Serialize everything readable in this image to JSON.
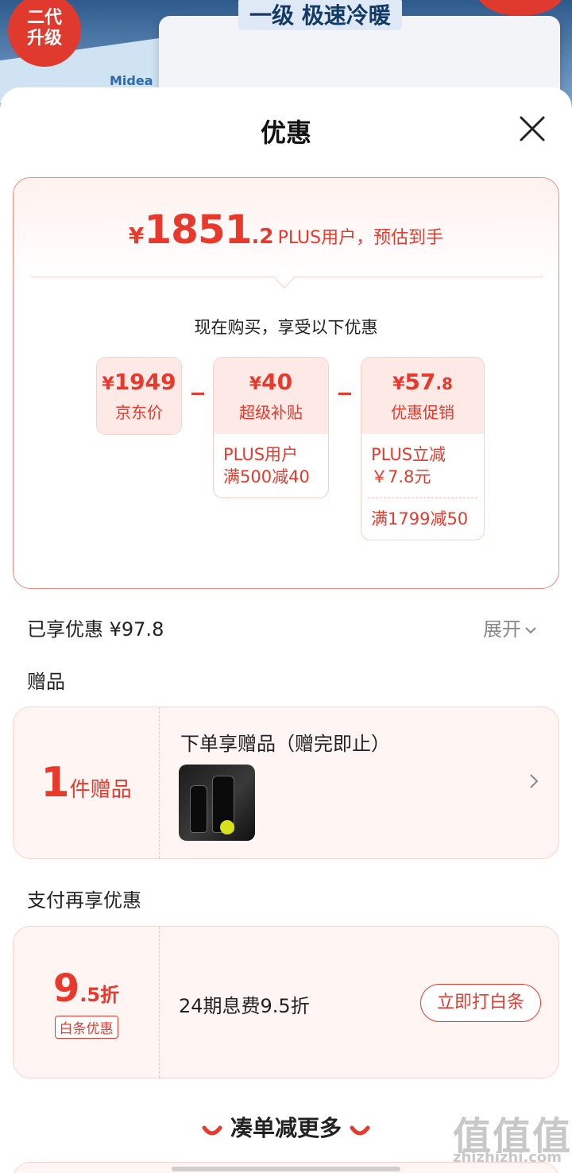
{
  "background": {
    "badge_text": "二代\n升级",
    "slogan": "一级 极速冷暖",
    "brand": "Midea"
  },
  "sheet": {
    "title": "优惠",
    "final_price": {
      "currency": "¥",
      "integer": "1851",
      "decimal": ".2",
      "suffix": "PLUS用户，预估到手"
    },
    "now_buy_text": "现在购买，享受以下优惠",
    "chips": [
      {
        "currency": "¥",
        "amount": "1949",
        "decimal": "",
        "name": "京东价",
        "details": []
      },
      {
        "currency": "¥",
        "amount": "40",
        "decimal": "",
        "name": "超级补贴",
        "details": [
          "PLUS用户\n满500减40"
        ]
      },
      {
        "currency": "¥",
        "amount": "57",
        "decimal": ".8",
        "name": "优惠促销",
        "details": [
          "PLUS立减\n￥7.8元",
          "满1799减50"
        ]
      }
    ],
    "enjoyed_label": "已享优惠 ¥97.8",
    "expand_label": "展开",
    "gift_section_title": "赠品",
    "gift": {
      "count": "1",
      "unit": "件赠品",
      "description": "下单享赠品（赠完即止）",
      "thumb_text": ""
    },
    "pay_section_title": "支付再享优惠",
    "pay": {
      "discount_big": "9",
      "discount_small": ".5折",
      "tag": "白条优惠",
      "description": "24期息费9.5折",
      "button": "立即打白条"
    },
    "more_title": "凑单减更多"
  },
  "watermark": {
    "main": "值值值",
    "sub": "zhizhizhi.com"
  },
  "colors": {
    "accent": "#e8392d",
    "chip_bg": "#fde9e6",
    "panel_bg": "#fff6f4"
  }
}
